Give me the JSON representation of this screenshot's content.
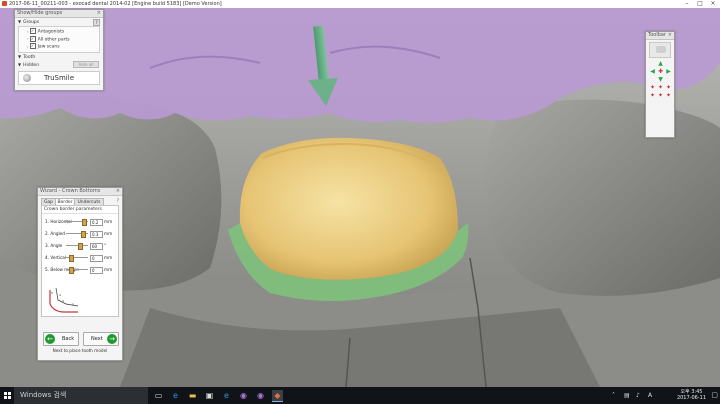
{
  "window": {
    "title": "2017-06-11_00211-003 - exocad dental 2014-02 [Engine build 5183] [Demo Version]",
    "minimize": "–",
    "maximize": "□",
    "close": "×"
  },
  "show_hide_panel": {
    "title": "Show/Hide groups",
    "close": "×",
    "groups_label": "Groups",
    "help": "?",
    "groups": [
      {
        "label": "Antagonists",
        "checked": "✓"
      },
      {
        "label": "All other parts",
        "checked": "✓"
      },
      {
        "label": "Jaw scans",
        "checked": "✓"
      }
    ],
    "tooth_label": "Tooth",
    "hidden_label": "Hidden",
    "hide_all_label": "Hide all",
    "trusmile_label": "TruSmile"
  },
  "toolbar_panel": {
    "title": "Toolbar",
    "close": "×",
    "buttons": [
      {
        "name": "blank-1",
        "glyph": ""
      },
      {
        "name": "arrow-up-icon",
        "glyph": "▲"
      },
      {
        "name": "blank-2",
        "glyph": ""
      },
      {
        "name": "arrow-left-icon",
        "glyph": "◀"
      },
      {
        "name": "rotate-center-icon",
        "glyph": "✚"
      },
      {
        "name": "arrow-right-icon",
        "glyph": "▶"
      },
      {
        "name": "blank-3",
        "glyph": ""
      },
      {
        "name": "arrow-down-icon",
        "glyph": "▼"
      },
      {
        "name": "blank-4",
        "glyph": ""
      },
      {
        "name": "tooth-view-1-icon",
        "glyph": "✦"
      },
      {
        "name": "tooth-view-2-icon",
        "glyph": "✦"
      },
      {
        "name": "tooth-view-3-icon",
        "glyph": "✦"
      },
      {
        "name": "tooth-view-4-icon",
        "glyph": "✦"
      },
      {
        "name": "tooth-view-5-icon",
        "glyph": "✦"
      },
      {
        "name": "tooth-view-6-icon",
        "glyph": "✦"
      }
    ]
  },
  "wizard_panel": {
    "title": "Wizard - Crown Bottoms",
    "close": "×",
    "tabs": [
      "Gap",
      "Border",
      "Undercuts"
    ],
    "active_tab": "Border",
    "help": "?",
    "section_title": "Crown border parameters",
    "params": [
      {
        "label": "1. Horizontal",
        "value": "0.2",
        "unit": "mm"
      },
      {
        "label": "2. Angled",
        "value": "0.3",
        "unit": "mm"
      },
      {
        "label": "3. Angle",
        "value": "60",
        "unit": "°"
      },
      {
        "label": "4. Vertical",
        "value": "0",
        "unit": "mm"
      },
      {
        "label": "5. Below margin",
        "value": "0",
        "unit": "mm"
      }
    ],
    "diagram_numbers": [
      "5",
      "4",
      "3",
      "1"
    ],
    "back_label": "Back",
    "next_label": "Next",
    "hint": "Next to place tooth model"
  },
  "taskbar": {
    "search_placeholder": "Windows 검색",
    "time": "오후 3:45",
    "date": "2017-06-11",
    "tray_label": "A"
  },
  "colors": {
    "antagonist": "#b89ad2",
    "crown": "#e9cd7e",
    "margin": "#7ec47a",
    "jaw": "#9b9b98",
    "next_button": "#1f9a2f"
  }
}
